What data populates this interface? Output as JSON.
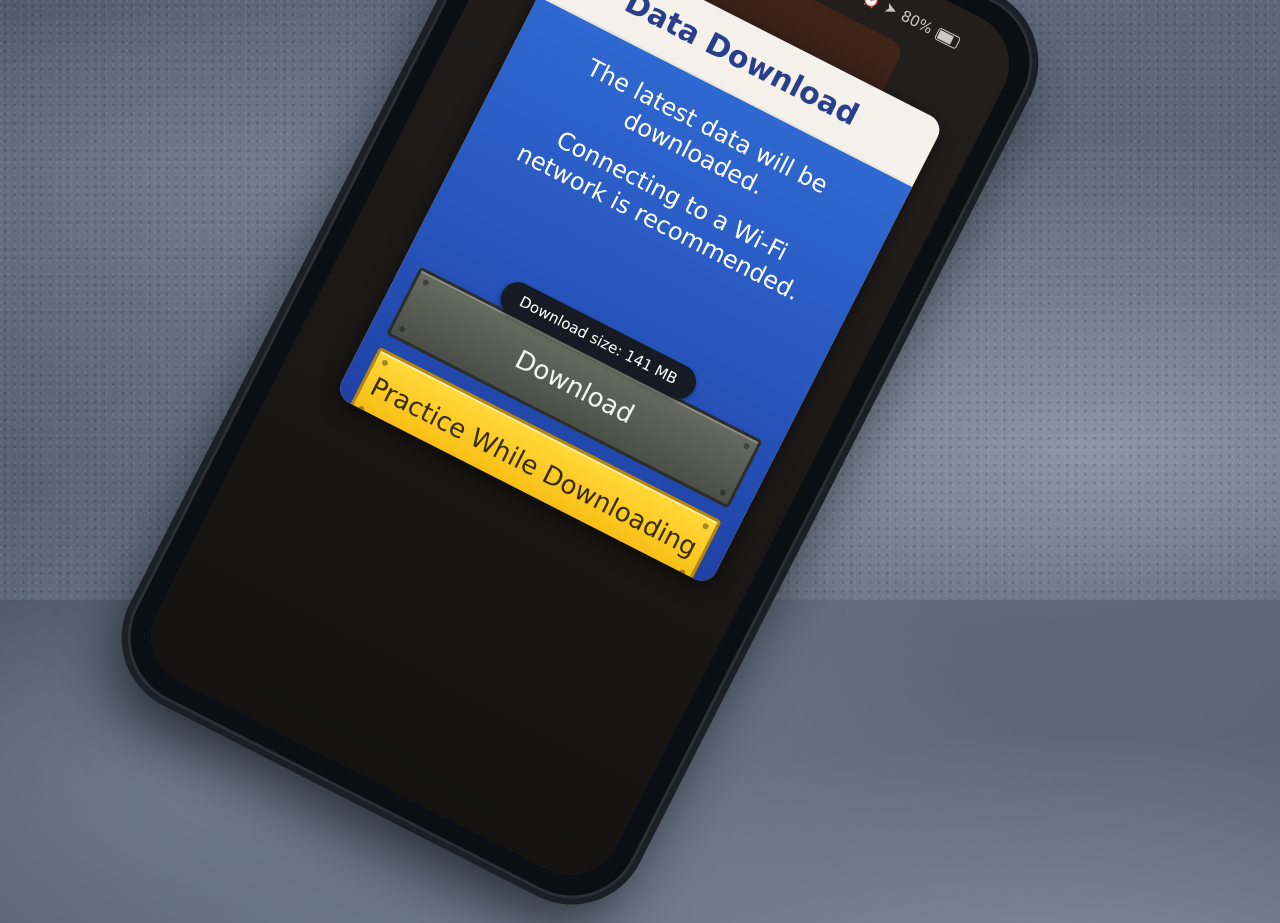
{
  "status_bar": {
    "battery_percent": "80%"
  },
  "dialog": {
    "title": "Data Download",
    "message_1": "The latest data will be downloaded.",
    "message_2": "Connecting to a Wi-Fi network is recommended.",
    "download_size": "Download size: 141 MB",
    "download_button": "Download",
    "practice_button": "Practice While Downloading"
  },
  "colors": {
    "title_text": "#2a3f8c",
    "dialog_body": "#2755bd",
    "practice_button": "#f6bb10",
    "download_button": "#4c4f47"
  }
}
